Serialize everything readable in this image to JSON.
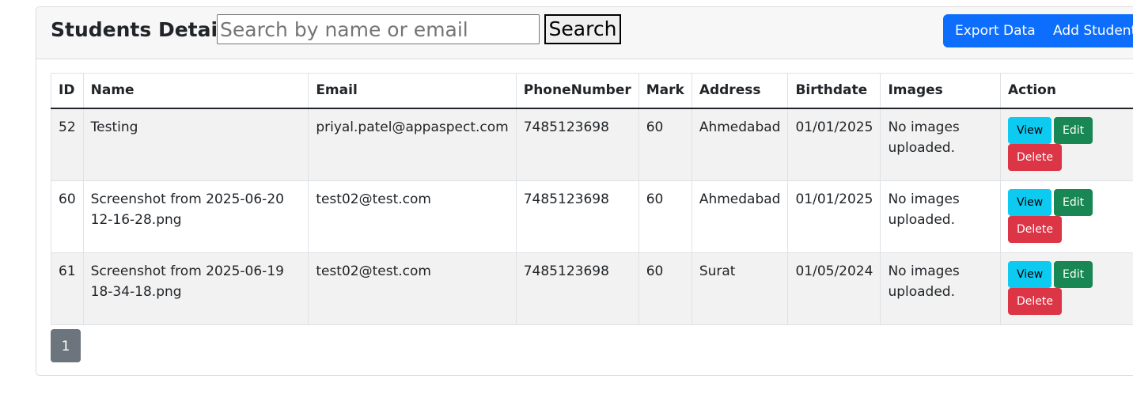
{
  "header": {
    "title": "Students Details",
    "search_placeholder": "Search by name or email",
    "search_value": "",
    "search_button": "Search",
    "export_button": "Export Data",
    "add_button": "Add Students"
  },
  "table": {
    "columns": [
      "ID",
      "Name",
      "Email",
      "PhoneNumber",
      "Mark",
      "Address",
      "Birthdate",
      "Images",
      "Action"
    ],
    "rows": [
      {
        "id": "52",
        "name": "Testing",
        "email": "priyal.patel@appaspect.com",
        "phone": "7485123698",
        "mark": "60",
        "address": "Ahmedabad",
        "birthdate": "01/01/2025",
        "images": "No images uploaded."
      },
      {
        "id": "60",
        "name": "Screenshot from 2025-06-20 12-16-28.png",
        "email": "test02@test.com",
        "phone": "7485123698",
        "mark": "60",
        "address": "Ahmedabad",
        "birthdate": "01/01/2025",
        "images": "No images uploaded."
      },
      {
        "id": "61",
        "name": "Screenshot from 2025-06-19 18-34-18.png",
        "email": "test02@test.com",
        "phone": "7485123698",
        "mark": "60",
        "address": "Surat",
        "birthdate": "01/05/2024",
        "images": "No images uploaded."
      }
    ],
    "actions": {
      "view": "View",
      "edit": "Edit",
      "delete": "Delete"
    }
  },
  "pagination": {
    "current_page": "1"
  },
  "colors": {
    "primary": "#0d6efd",
    "info": "#0dcaf0",
    "success": "#198754",
    "danger": "#dc3545",
    "secondary": "#6c757d"
  }
}
